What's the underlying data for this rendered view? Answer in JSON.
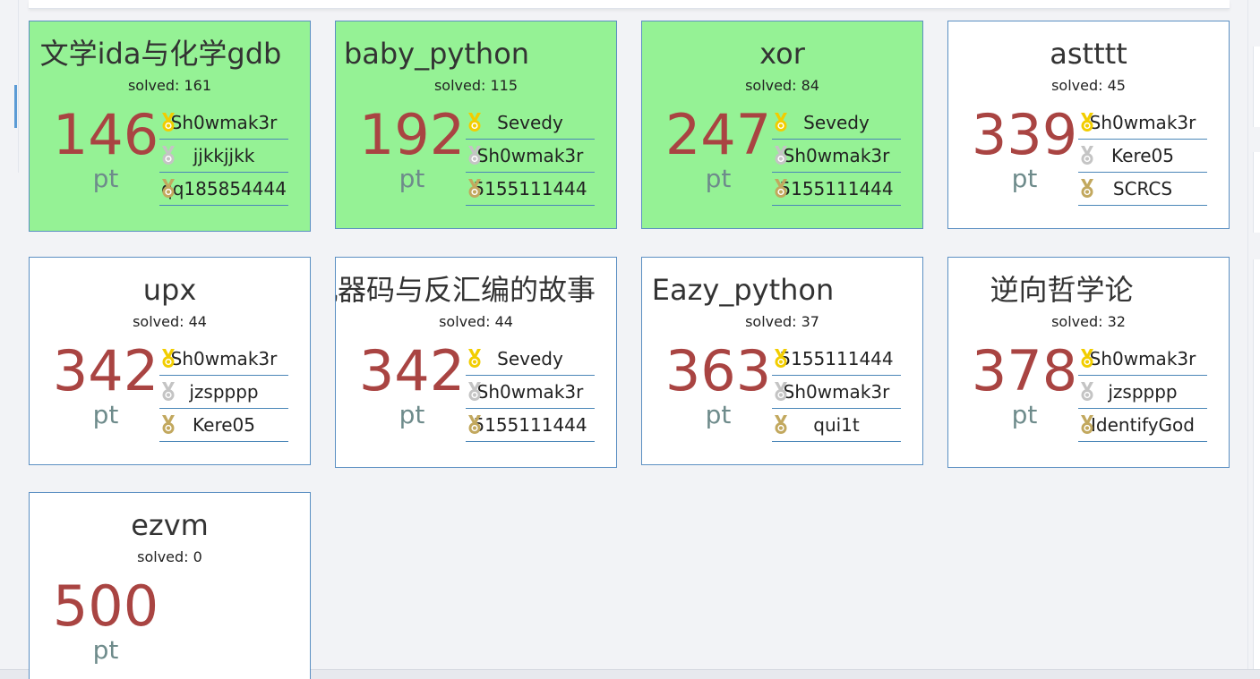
{
  "colors": {
    "solved_card_bg": "#95f295",
    "card_bg": "#ffffff",
    "card_border": "#5b8fc2",
    "points_color": "#a94442",
    "pt_color": "#6e8b8b",
    "gold": "#f2cd00",
    "silver": "#c4c4c4",
    "bronze": "#c2a85e"
  },
  "challenges": [
    {
      "title": "文学ida与化学gdb",
      "solved": "solved: 161",
      "points": "146",
      "unit": "pt",
      "solved_by_me": true,
      "solvers": [
        {
          "medal": "gold-medal-icon",
          "name": "Sh0wmak3r"
        },
        {
          "medal": "silver-medal-icon",
          "name": "jjkkjjkk"
        },
        {
          "medal": "bronze-medal-icon",
          "name": "qq185854444"
        }
      ]
    },
    {
      "title": "baby_python",
      "solved": "solved: 115",
      "points": "192",
      "unit": "pt",
      "solved_by_me": true,
      "solvers": [
        {
          "medal": "gold-medal-icon",
          "name": "Sevedy"
        },
        {
          "medal": "silver-medal-icon",
          "name": "Sh0wmak3r"
        },
        {
          "medal": "bronze-medal-icon",
          "name": "5155111444"
        }
      ]
    },
    {
      "title": "xor",
      "solved": "solved: 84",
      "points": "247",
      "unit": "pt",
      "solved_by_me": true,
      "solvers": [
        {
          "medal": "gold-medal-icon",
          "name": "Sevedy"
        },
        {
          "medal": "silver-medal-icon",
          "name": "Sh0wmak3r"
        },
        {
          "medal": "bronze-medal-icon",
          "name": "5155111444"
        }
      ]
    },
    {
      "title": "astttt",
      "solved": "solved: 45",
      "points": "339",
      "unit": "pt",
      "solved_by_me": false,
      "solvers": [
        {
          "medal": "gold-medal-icon",
          "name": "Sh0wmak3r"
        },
        {
          "medal": "silver-medal-icon",
          "name": "Kere05"
        },
        {
          "medal": "bronze-medal-icon",
          "name": "SCRCS"
        }
      ]
    },
    {
      "title": "upx",
      "solved": "solved: 44",
      "points": "342",
      "unit": "pt",
      "solved_by_me": false,
      "solvers": [
        {
          "medal": "gold-medal-icon",
          "name": "Sh0wmak3r"
        },
        {
          "medal": "silver-medal-icon",
          "name": "jzspppp"
        },
        {
          "medal": "bronze-medal-icon",
          "name": "Kere05"
        }
      ]
    },
    {
      "title": "机器码与反汇编的故事",
      "solved": "solved: 44",
      "points": "342",
      "unit": "pt",
      "solved_by_me": false,
      "solvers": [
        {
          "medal": "gold-medal-icon",
          "name": "Sevedy"
        },
        {
          "medal": "silver-medal-icon",
          "name": "Sh0wmak3r"
        },
        {
          "medal": "bronze-medal-icon",
          "name": "5155111444"
        }
      ]
    },
    {
      "title": "Eazy_python",
      "solved": "solved: 37",
      "points": "363",
      "unit": "pt",
      "solved_by_me": false,
      "solvers": [
        {
          "medal": "gold-medal-icon",
          "name": "5155111444"
        },
        {
          "medal": "silver-medal-icon",
          "name": "Sh0wmak3r"
        },
        {
          "medal": "bronze-medal-icon",
          "name": "qui1t"
        }
      ]
    },
    {
      "title": "逆向哲学论",
      "solved": "solved: 32",
      "points": "378",
      "unit": "pt",
      "solved_by_me": false,
      "solvers": [
        {
          "medal": "gold-medal-icon",
          "name": "Sh0wmak3r"
        },
        {
          "medal": "silver-medal-icon",
          "name": "jzspppp"
        },
        {
          "medal": "bronze-medal-icon",
          "name": "IdentifyGod"
        }
      ]
    },
    {
      "title": "ezvm",
      "solved": "solved: 0",
      "points": "500",
      "unit": "pt",
      "solved_by_me": false,
      "solvers": []
    }
  ]
}
